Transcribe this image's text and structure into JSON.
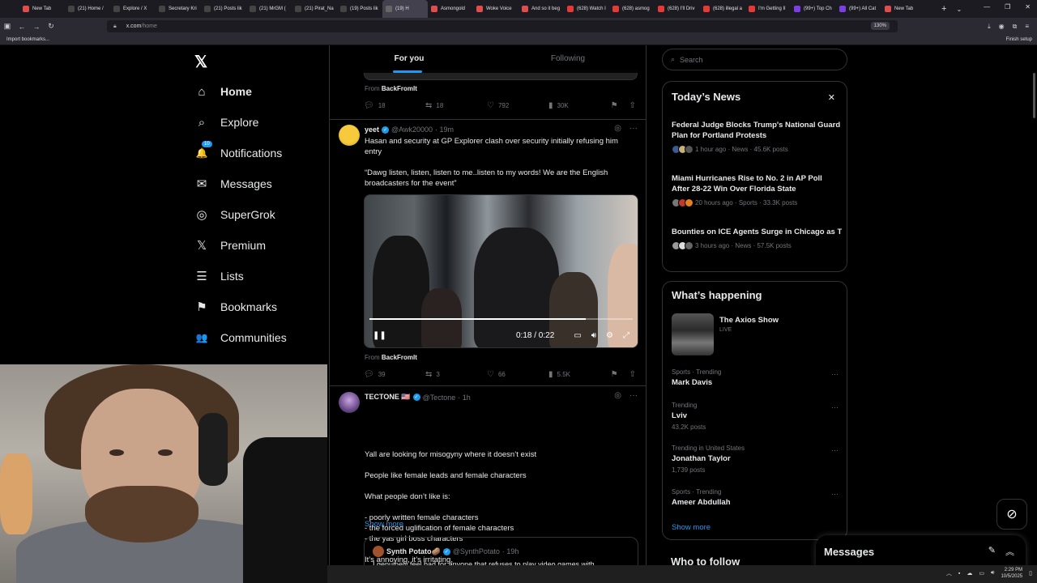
{
  "browser": {
    "tabs": [
      {
        "label": "New Tab",
        "color": "#e24c4c"
      },
      {
        "label": "(21) Home /",
        "color": "#444"
      },
      {
        "label": "Explore / X",
        "color": "#444"
      },
      {
        "label": "Secretary Kri",
        "color": "#444"
      },
      {
        "label": "(21) Posts lik",
        "color": "#444"
      },
      {
        "label": "(21) MrGM (",
        "color": "#444"
      },
      {
        "label": "(21) Pirat_Na",
        "color": "#444"
      },
      {
        "label": "(19) Posts lik",
        "color": "#444"
      },
      {
        "label": "(19) H",
        "color": "#666",
        "active": true
      },
      {
        "label": "Asmongold",
        "color": "#e24c4c"
      },
      {
        "label": "Woke Voice",
        "color": "#e24c4c"
      },
      {
        "label": "And so it beg",
        "color": "#e24c4c"
      },
      {
        "label": "(628) Watch I",
        "color": "#e53935"
      },
      {
        "label": "(628) asmog",
        "color": "#e53935"
      },
      {
        "label": "(628) I'll Driv",
        "color": "#e53935"
      },
      {
        "label": "(628) illegal a",
        "color": "#e53935"
      },
      {
        "label": "I'm Getting Il",
        "color": "#e53935"
      },
      {
        "label": "(99+) Top Ch",
        "color": "#7b3fe4"
      },
      {
        "label": "(99+) All Cat",
        "color": "#7b3fe4"
      },
      {
        "label": "New Tab",
        "color": "#e24c4c"
      }
    ],
    "new_tab": "+",
    "url_host": "x.com",
    "url_path": "/home",
    "zoom": "130%",
    "bookmark": "Import bookmarks...",
    "finish_setup": "Finish setup"
  },
  "sidebar": {
    "logo": "𝕏",
    "items": [
      {
        "label": "Home",
        "icon": "⌂"
      },
      {
        "label": "Explore",
        "icon": "⌕"
      },
      {
        "label": "Notifications",
        "icon": "🔔",
        "badge": "10"
      },
      {
        "label": "Messages",
        "icon": "✉"
      },
      {
        "label": "SuperGrok",
        "icon": "◎"
      },
      {
        "label": "Premium",
        "icon": "𝕏"
      },
      {
        "label": "Lists",
        "icon": "☰"
      },
      {
        "label": "Bookmarks",
        "icon": "⚑"
      },
      {
        "label": "Communities",
        "icon": "👥"
      }
    ]
  },
  "timeline": {
    "tabs": [
      "For you",
      "Following"
    ],
    "prev_post": {
      "from_label": "From",
      "from_source": "BackFromIt",
      "replies": "18",
      "reposts": "18",
      "likes": "792",
      "views": "30K"
    },
    "posts": [
      {
        "name": "yeet",
        "handle": "@Awk20000",
        "time": "· 19m",
        "text": [
          "Hasan and security at GP Explorer clash over security initially refusing him entry",
          "“Dawg listen, listen, listen to me..listen to my words! We are the English broadcasters for the event”"
        ],
        "video": {
          "time": "0:18 / 0:22",
          "progress": 0.82
        },
        "from_label": "From",
        "from_source": "BackFromIt",
        "replies": "39",
        "reposts": "3",
        "likes": "66",
        "views": "5.5K"
      },
      {
        "name": "TECTONE 🇺🇸",
        "handle": "@Tectone",
        "time": "· 1h",
        "text": [
          "Yall are looking for misogyny where it doesn’t exist",
          "People like female leads and female characters",
          "What people don’t like is:",
          "- poorly written female characters\n- the forced uglification of female characters\n- the yas girl boss characters",
          "It’s annoying, it’s irritating,"
        ],
        "show_more": "Show more",
        "quote": {
          "name": "Synth Potato🥔",
          "handle": "@SynthPotato",
          "time": "· 19h",
          "text": "I genuinely feel bad for anyone that refuses to play video games with"
        }
      }
    ]
  },
  "right": {
    "search_placeholder": "Search",
    "news": {
      "title": "Today’s News",
      "items": [
        {
          "headline": "Federal Judge Blocks Trump's National Guard Plan for Portland Protests",
          "meta": "1 hour ago · News · 45.6K posts"
        },
        {
          "headline": "Miami Hurricanes Rise to No. 2 in AP Poll After 28-22 Win Over Florida State",
          "meta": "20 hours ago · Sports · 33.3K posts"
        },
        {
          "headline": "Bounties on ICE Agents Surge in Chicago as Trump Deploys National Guard Amid Local…",
          "meta": "3 hours ago · News · 57.5K posts"
        }
      ]
    },
    "happening": {
      "title": "What’s happening",
      "featured_title": "The Axios Show",
      "featured_status": "LIVE",
      "trends": [
        {
          "category": "Sports · Trending",
          "topic": "Mark Davis",
          "count": ""
        },
        {
          "category": "Trending",
          "topic": "Lviv",
          "count": "43.2K posts"
        },
        {
          "category": "Trending in United States",
          "topic": "Jonathan Taylor",
          "count": "1,739 posts"
        },
        {
          "category": "Sports · Trending",
          "topic": "Ameer Abdullah",
          "count": ""
        }
      ],
      "show_more": "Show more"
    },
    "who_to_follow": "Who to follow",
    "messages_drawer": "Messages"
  },
  "taskbar": {
    "time": "2:29 PM",
    "date": "10/5/2025"
  },
  "colors": {
    "accent": "#1d9bf0",
    "background": "#000000",
    "border": "#2f3336",
    "muted": "#71767b"
  }
}
